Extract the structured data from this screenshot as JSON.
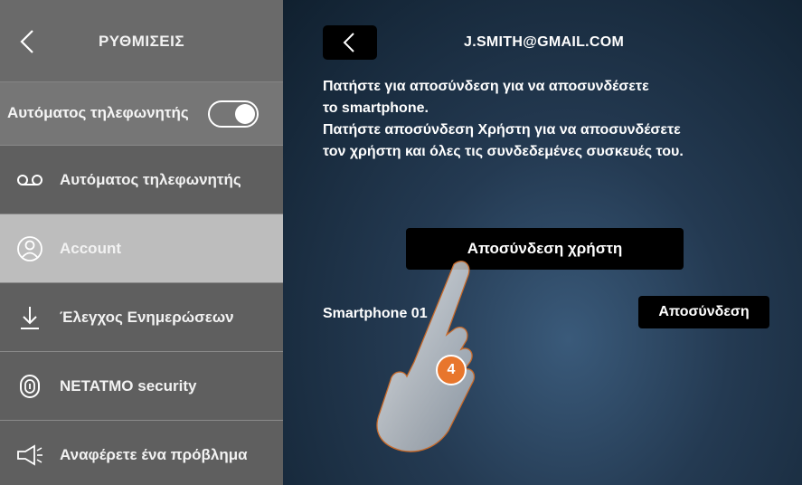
{
  "sidebar": {
    "title": "ΡΥΘΜΙΣΕΙΣ",
    "toggle": {
      "label": "Αυτόματος τηλεφωνητής",
      "state": "on"
    },
    "items": [
      {
        "label": "Αυτόματος τηλεφωνητής",
        "icon": "voicemail-icon",
        "active": false
      },
      {
        "label": "Account",
        "icon": "user-icon",
        "active": true
      },
      {
        "label": "Έλεγχος Ενημερώσεων",
        "icon": "download-icon",
        "active": false
      },
      {
        "label": "NETATMO security",
        "icon": "fingerprint-icon",
        "active": false
      },
      {
        "label": "Αναφέρετε ένα πρόβλημα",
        "icon": "megaphone-icon",
        "active": false
      }
    ]
  },
  "main": {
    "account_email": "J.SMITH@GMAIL.COM",
    "instructions": [
      "Πατήστε για αποσύνδεση για να αποσυνδέσετε",
      "το smartphone.",
      "Πατήστε αποσύνδεση Χρήστη για να αποσυνδέσετε",
      "τον χρήστη και όλες τις συνδεδεμένες συσκευές του."
    ],
    "disconnect_user_label": "Αποσύνδεση χρήστη",
    "device_name": "Smartphone 01",
    "disconnect_label": "Αποσύνδεση",
    "step_number": "4"
  },
  "colors": {
    "accent": "#e8762c",
    "active_item": "#bdbdbd"
  }
}
